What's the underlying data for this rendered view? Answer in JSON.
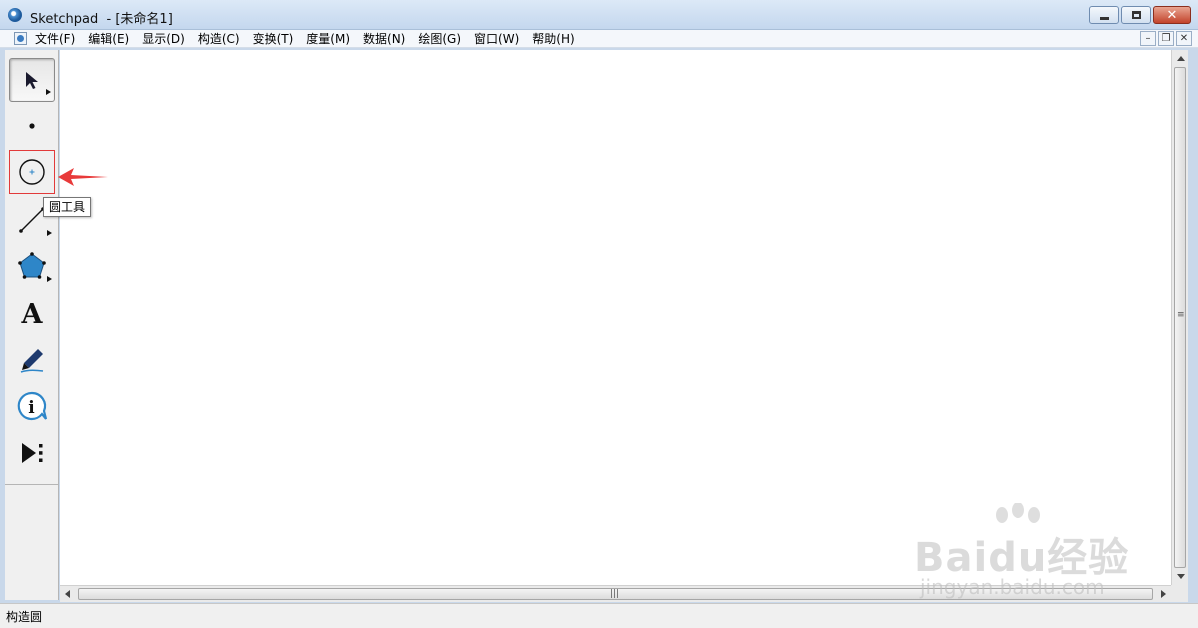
{
  "window": {
    "title": "Sketchpad  - [未命名1]"
  },
  "menu": {
    "items": [
      "文件(F)",
      "编辑(E)",
      "显示(D)",
      "构造(C)",
      "变换(T)",
      "度量(M)",
      "数据(N)",
      "绘图(G)",
      "窗口(W)",
      "帮助(H)"
    ]
  },
  "toolbox": {
    "tools": [
      {
        "name": "selection-arrow-tool",
        "selected": true
      },
      {
        "name": "point-tool"
      },
      {
        "name": "compass-tool",
        "highlighted": true
      },
      {
        "name": "straightedge-tool"
      },
      {
        "name": "polygon-tool"
      },
      {
        "name": "text-tool"
      },
      {
        "name": "marker-tool"
      },
      {
        "name": "information-tool"
      },
      {
        "name": "custom-tool"
      }
    ],
    "tooltip": "圆工具"
  },
  "statusbar": {
    "text": "构造圆"
  },
  "watermark": {
    "logo": "Baidu经验",
    "url": "jingyan.baidu.com"
  },
  "colors": {
    "annotation_red": "#e83a3a",
    "tool_blue": "#2e86c8",
    "titlebar": "#c4d7ee"
  }
}
